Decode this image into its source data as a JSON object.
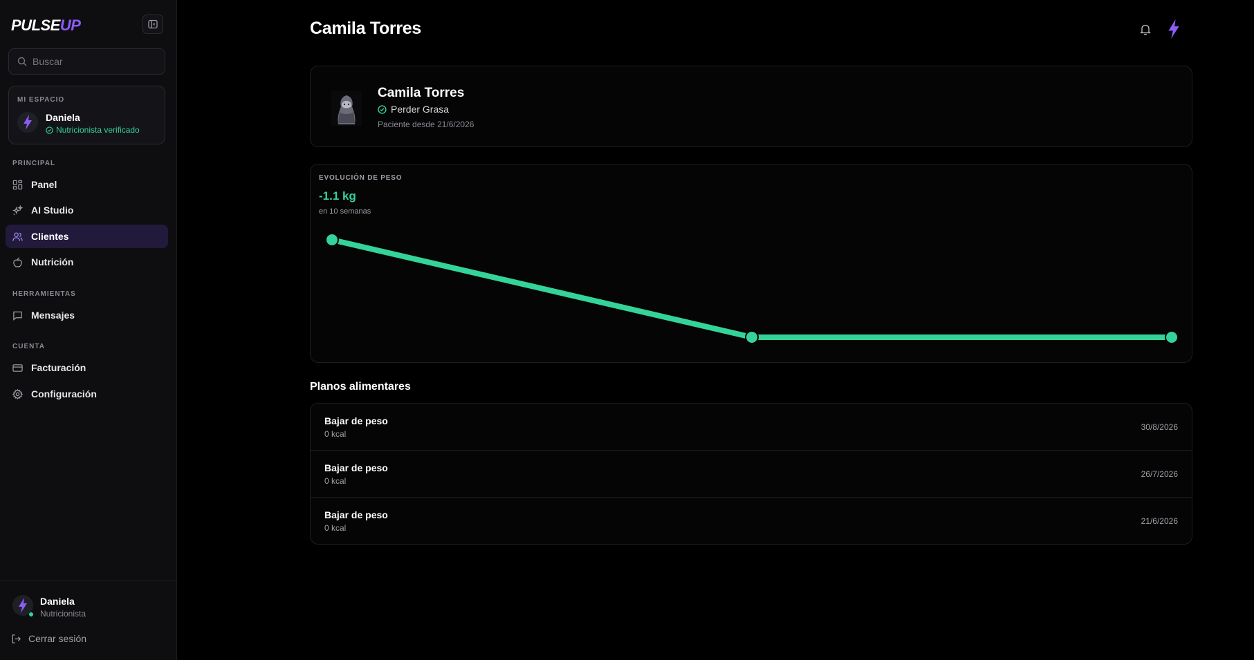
{
  "app": {
    "logo_part1": "PULSE",
    "logo_part2": "UP",
    "brand_color": "#8b5cf6",
    "accent_color": "#34d399"
  },
  "sidebar": {
    "search_placeholder": "Buscar",
    "workspace": {
      "label": "MI ESPACIO",
      "name": "Daniela",
      "role": "Nutricionista verificado"
    },
    "sections": [
      {
        "label": "PRINCIPAL",
        "items": [
          {
            "label": "Panel",
            "icon": "grid-icon"
          },
          {
            "label": "AI Studio",
            "icon": "sparkles-icon"
          },
          {
            "label": "Clientes",
            "icon": "users-icon",
            "active": true
          },
          {
            "label": "Nutrición",
            "icon": "apple-icon"
          }
        ]
      },
      {
        "label": "HERRAMIENTAS",
        "items": [
          {
            "label": "Mensajes",
            "icon": "message-icon"
          }
        ]
      },
      {
        "label": "CUENTA",
        "items": [
          {
            "label": "Facturación",
            "icon": "credit-card-icon"
          },
          {
            "label": "Configuración",
            "icon": "gear-icon"
          }
        ]
      }
    ],
    "user": {
      "name": "Daniela",
      "role": "Nutricionista"
    },
    "logout_label": "Cerrar sesión"
  },
  "header": {
    "title": "Camila Torres",
    "icons": [
      "bell-icon",
      "bolt-icon"
    ]
  },
  "profile": {
    "name": "Camila Torres",
    "goal": "Perder Grasa",
    "since": "Paciente desde 21/6/2026"
  },
  "weight_chart": {
    "label": "EVOLUCIÓN DE PESO",
    "delta": "-1.1 kg",
    "subtitle": "en 10 semanas",
    "line_color": "#34d399"
  },
  "chart_data": {
    "type": "line",
    "title": "EVOLUCIÓN DE PESO",
    "x": [
      1,
      2,
      3
    ],
    "series": [
      {
        "values": [
          1.1,
          0,
          0
        ]
      }
    ],
    "ylim": [
      0,
      1.1
    ],
    "grid": false
  },
  "plans": {
    "title": "Planos alimentares",
    "items": [
      {
        "name": "Bajar de peso",
        "kcal": "0 kcal",
        "date": "30/8/2026"
      },
      {
        "name": "Bajar de peso",
        "kcal": "0 kcal",
        "date": "26/7/2026"
      },
      {
        "name": "Bajar de peso",
        "kcal": "0 kcal",
        "date": "21/6/2026"
      }
    ]
  }
}
